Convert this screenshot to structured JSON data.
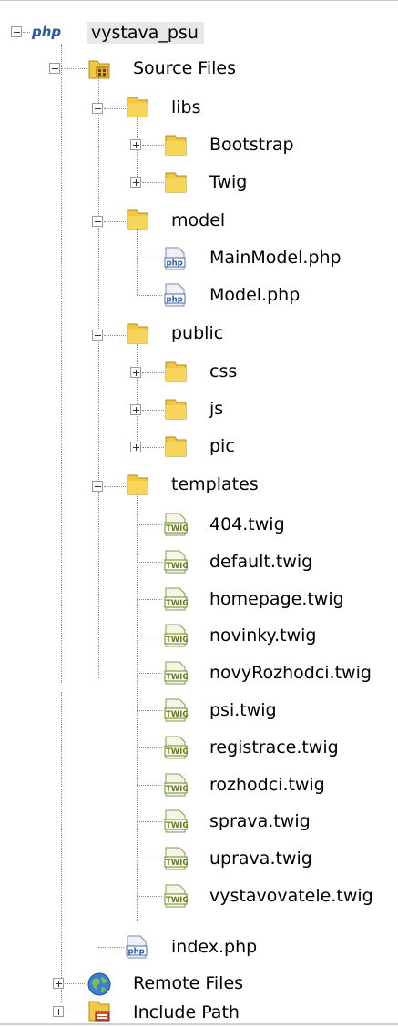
{
  "tree": {
    "project": {
      "label": "vystava_psu",
      "badge": "php"
    },
    "source_files": "Source Files",
    "libs": "libs",
    "bootstrap": "Bootstrap",
    "twig_lib": "Twig",
    "model": "model",
    "main_model": "MainModel.php",
    "model_php": "Model.php",
    "public": "public",
    "css": "css",
    "js": "js",
    "pic": "pic",
    "templates": "templates",
    "twig_files": [
      "404.twig",
      "default.twig",
      "homepage.twig",
      "novinky.twig",
      "novyRozhodci.twig",
      "psi.twig",
      "registrace.twig",
      "rozhodci.twig",
      "sprava.twig",
      "uprava.twig",
      "vystavovatele.twig"
    ],
    "index_php": "index.php",
    "remote_files": "Remote Files",
    "include_path": "Include Path"
  },
  "icons": {
    "php_file": "php-file-icon",
    "twig_file": "twig-file-icon",
    "folder": "folder-icon",
    "source_folder": "source-folder-icon",
    "globe": "globe-icon",
    "include": "include-path-icon"
  },
  "colors": {
    "folder": "#f2c744",
    "selection": "#e8e8e8",
    "twig_green": "#7a9a1f",
    "php_blue": "#2a5aa8"
  }
}
